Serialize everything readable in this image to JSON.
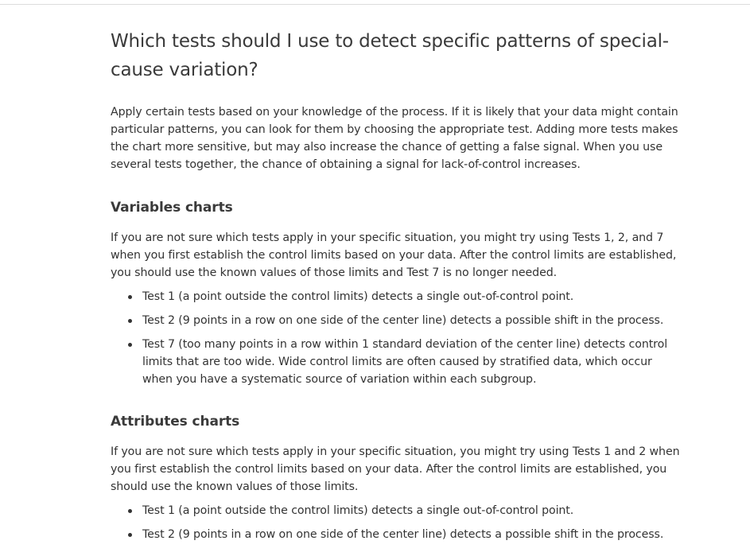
{
  "page": {
    "title": "Which tests should I use to detect specific patterns of special-cause variation?",
    "intro": "Apply certain tests based on your knowledge of the process. If it is likely that your data might contain particular patterns, you can look for them by choosing the appropriate test. Adding more tests makes the chart more sensitive, but may also increase the chance of getting a false signal. When you use several tests together, the chance of obtaining a signal for lack-of-control increases."
  },
  "sections": [
    {
      "title": "Variables charts",
      "paragraph": "If you are not sure which tests apply in your specific situation, you might try using Tests 1, 2, and 7 when you first establish the control limits based on your data. After the control limits are established, you should use the known values of those limits and Test 7 is no longer needed.",
      "bullets": [
        "Test 1 (a point outside the control limits) detects a single out-of-control point.",
        "Test 2 (9 points in a row on one side of the center line) detects a possible shift in the process.",
        "Test 7 (too many points in a row within 1 standard deviation of the center line) detects control limits that are too wide. Wide control limits are often caused by stratified data, which occur when you have a systematic source of variation within each subgroup."
      ]
    },
    {
      "title": "Attributes charts",
      "paragraph": "If you are not sure which tests apply in your specific situation, you might try using Tests 1 and 2 when you first establish the control limits based on your data. After the control limits are established, you should use the known values of those limits.",
      "bullets": [
        "Test 1 (a point outside the control limits) detects a single out-of-control point.",
        "Test 2 (9 points in a row on one side of the center line) detects a possible shift in the process."
      ]
    }
  ]
}
